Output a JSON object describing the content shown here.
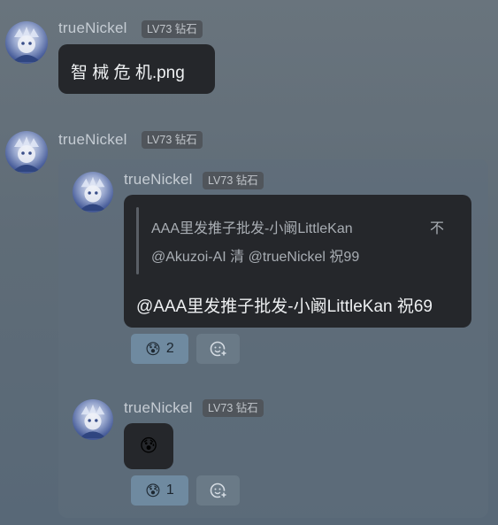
{
  "messages": [
    {
      "user": "trueNickel",
      "badge": "LV73 钻石",
      "text": "智 械 危 机.png"
    },
    {
      "user": "trueNickel",
      "badge": "LV73 钻石"
    }
  ],
  "thread": {
    "reply": {
      "user": "trueNickel",
      "badge": "LV73 钻石",
      "quote_line1": "AAA里发推子批发-小阚LittleKan",
      "quote_line2": "@Akuzoi-AI 清 @trueNickel 祝99",
      "quote_collapse": "不",
      "text": "@AAA里发推子批发-小阚LittleKan 祝69",
      "reaction_emoji": "😰",
      "reaction_count": "2"
    },
    "second": {
      "user": "trueNickel",
      "badge": "LV73 钻石",
      "emoji_message": "😰",
      "reaction_emoji": "😰",
      "reaction_count": "1"
    }
  },
  "colors": {
    "bubble": "#25272b",
    "reaction_active": "#6f8aa0",
    "background": "#5f6c77"
  },
  "icons": [
    "avatar",
    "add-reaction-icon"
  ]
}
